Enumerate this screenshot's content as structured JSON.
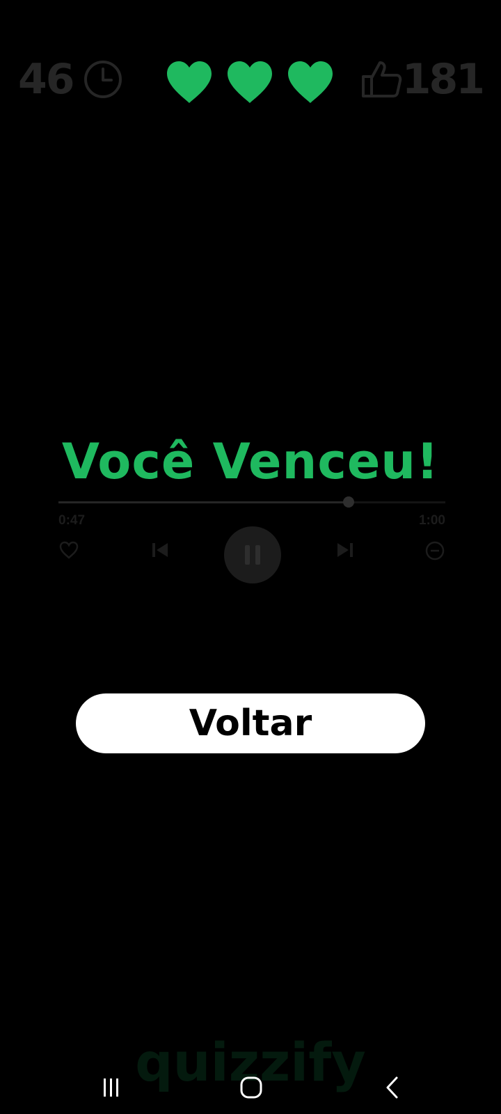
{
  "stats": {
    "timer_value": "46",
    "lives": 3,
    "likes_value": "181"
  },
  "result": {
    "title": "Você Venceu!"
  },
  "player": {
    "current_time": "0:47",
    "total_time": "1:00",
    "progress": 0.75
  },
  "actions": {
    "back_label": "Voltar"
  },
  "brand": {
    "logo_text": "quizzify"
  },
  "icons": {
    "timer": "clock-icon",
    "life": "heart-icon",
    "likes": "thumbs-up-icon",
    "player_like": "heart-outline-icon",
    "player_prev": "skip-previous-icon",
    "player_pause": "pause-icon",
    "player_next": "skip-next-icon",
    "player_hide": "minus-circle-icon",
    "nav_recents": "recents-icon",
    "nav_home": "home-icon",
    "nav_back": "back-icon"
  },
  "colors": {
    "accent": "#1fb95f",
    "background": "#000000",
    "button_bg": "#ffffff",
    "dimmed_text": "#262626"
  }
}
